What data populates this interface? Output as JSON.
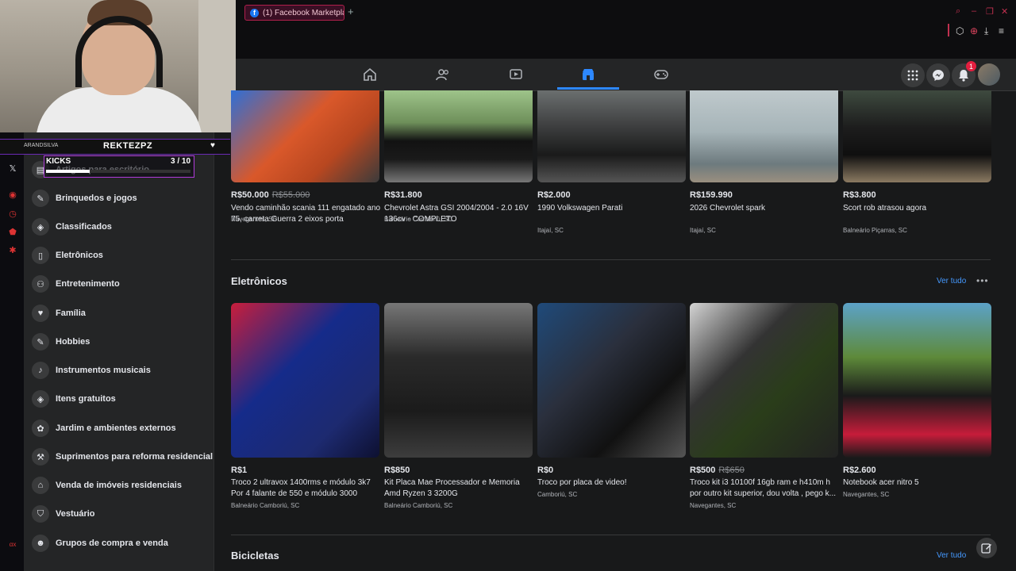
{
  "browser": {
    "tab_title": "(1) Facebook Marketplace",
    "tab_favicon": "f",
    "new_tab_symbol": "+"
  },
  "stream_overlay": {
    "streamer_name": "REKTEZPZ",
    "handle": "ARANDSILVA",
    "goal_label": "KICKS",
    "goal_current": "3",
    "goal_total": "/ 10",
    "goal_fraction": 0.3
  },
  "sidebar": {
    "items": [
      {
        "label": "Artigos para escritório",
        "icon": "briefcase-icon"
      },
      {
        "label": "Brinquedos e jogos",
        "icon": "toy-icon"
      },
      {
        "label": "Classificados",
        "icon": "tag-icon"
      },
      {
        "label": "Eletrônicos",
        "icon": "phone-icon"
      },
      {
        "label": "Entretenimento",
        "icon": "people-icon"
      },
      {
        "label": "Família",
        "icon": "heart-icon"
      },
      {
        "label": "Hobbies",
        "icon": "pencil-icon"
      },
      {
        "label": "Instrumentos musicais",
        "icon": "guitar-icon"
      },
      {
        "label": "Itens gratuitos",
        "icon": "tag-icon"
      },
      {
        "label": "Jardim e ambientes externos",
        "icon": "garden-icon"
      },
      {
        "label": "Suprimentos para reforma residencial",
        "icon": "wrench-icon"
      },
      {
        "label": "Venda de imóveis residenciais",
        "icon": "house-icon"
      },
      {
        "label": "Vestuário",
        "icon": "shirt-icon"
      },
      {
        "label": "Grupos de compra e venda",
        "icon": "group-icon"
      }
    ]
  },
  "header": {
    "notification_count": "1"
  },
  "vehicles_row": [
    {
      "price": "R$50.000",
      "old_price": "R$55.000",
      "title": "Vendo caminhão scania 111 engatado ano 75, carreta Guerra 2 eixos porta containe...",
      "location": "Navegantes, SC"
    },
    {
      "price": "R$31.800",
      "old_price": "",
      "title": "Chevrolet Astra GSI 2004/2004 - 2.0 16V 136cv - COMPLETO",
      "location": "Balneário Camboriú, SC"
    },
    {
      "price": "R$2.000",
      "old_price": "",
      "title": "1990 Volkswagen Parati",
      "location": "Itajaí, SC"
    },
    {
      "price": "R$159.990",
      "old_price": "",
      "title": "2026 Chevrolet spark",
      "location": "Itajaí, SC"
    },
    {
      "price": "R$3.800",
      "old_price": "",
      "title": "Scort rob atrasou agora",
      "location": "Balneário Piçarras, SC"
    }
  ],
  "electronics": {
    "title": "Eletrônicos",
    "see_all": "Ver tudo",
    "more": "•••",
    "items": [
      {
        "price": "R$1",
        "old_price": "",
        "title": "Troco 2 ultravox 1400rms e módulo 3k7 Por 4 falante de 550 e módulo 3000",
        "location": "Balneário Camboriú, SC"
      },
      {
        "price": "R$850",
        "old_price": "",
        "title": "Kit Placa Mae Processador e Memoria Amd Ryzen 3 3200G",
        "location": "Balneário Camboriú, SC"
      },
      {
        "price": "R$0",
        "old_price": "",
        "title": "Troco por placa de video!",
        "location": "Camboriú, SC"
      },
      {
        "price": "R$500",
        "old_price": "R$650",
        "title": "Troco kit i3 10100f 16gb ram e h410m h por outro kit superior, dou volta , pego k...",
        "location": "Navegantes, SC"
      },
      {
        "price": "R$2.600",
        "old_price": "",
        "title": "Notebook acer nitro 5",
        "location": "Navegantes, SC"
      }
    ]
  },
  "bicycles": {
    "title": "Bicicletas",
    "see_all": "Ver tudo"
  },
  "colors": {
    "accent": "#2d88ff",
    "background": "#18191a",
    "card": "#242526"
  }
}
